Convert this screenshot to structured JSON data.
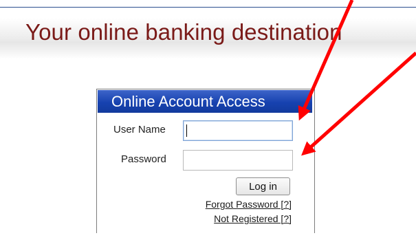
{
  "headline": "Your online banking destination",
  "login_panel": {
    "title": "Online Account Access",
    "username_label": "User Name",
    "username_value": "",
    "password_label": "Password",
    "password_value": "",
    "login_button": "Log in",
    "forgot_password_link": "Forgot Password [?]",
    "not_registered_link": "Not Registered [?]"
  },
  "colors": {
    "headline": "#7a1a18",
    "panel_header": "#1742b0",
    "annotation_arrow": "#ff0000"
  },
  "annotations": [
    "red-arrow",
    "red-arrow"
  ]
}
